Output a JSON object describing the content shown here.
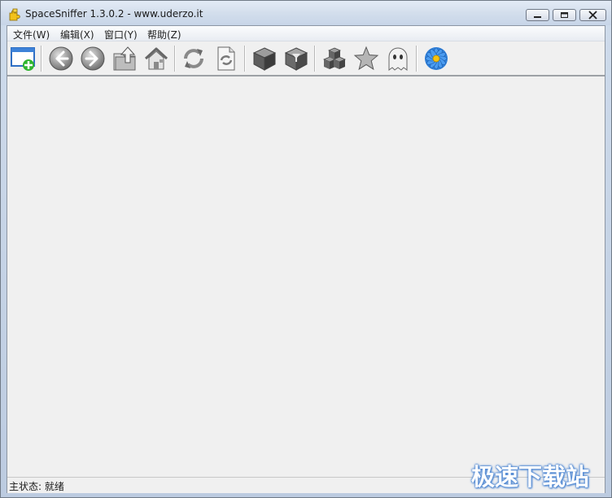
{
  "window": {
    "title": "SpaceSniffer 1.3.0.2 - www.uderzo.it",
    "app_icon": "puzzle-icon",
    "controls": [
      "minimize",
      "maximize",
      "close"
    ]
  },
  "menubar": {
    "items": [
      {
        "label": "文件(W)"
      },
      {
        "label": "编辑(X)"
      },
      {
        "label": "窗口(Y)"
      },
      {
        "label": "帮助(Z)"
      }
    ]
  },
  "toolbar": {
    "buttons": [
      {
        "icon": "new-window-plus-icon"
      },
      {
        "icon": "back-arrow-icon"
      },
      {
        "icon": "forward-arrow-icon"
      },
      {
        "icon": "folder-up-icon"
      },
      {
        "icon": "home-icon"
      },
      {
        "icon": "refresh-icon"
      },
      {
        "icon": "refresh-document-icon"
      },
      {
        "icon": "cube-icon"
      },
      {
        "icon": "cube-filter-icon"
      },
      {
        "icon": "cubes-icon"
      },
      {
        "icon": "star-icon"
      },
      {
        "icon": "ghost-icon"
      },
      {
        "icon": "settings-flower-icon"
      }
    ]
  },
  "statusbar": {
    "text": "主状态: 就绪"
  },
  "watermark": {
    "text": "极速下载站"
  },
  "colors": {
    "frame": "#c7d5e8",
    "client_bg": "#f0f0f0",
    "accent_blue": "#2f7fd8",
    "watermark_outline": "#3e7ccd"
  }
}
